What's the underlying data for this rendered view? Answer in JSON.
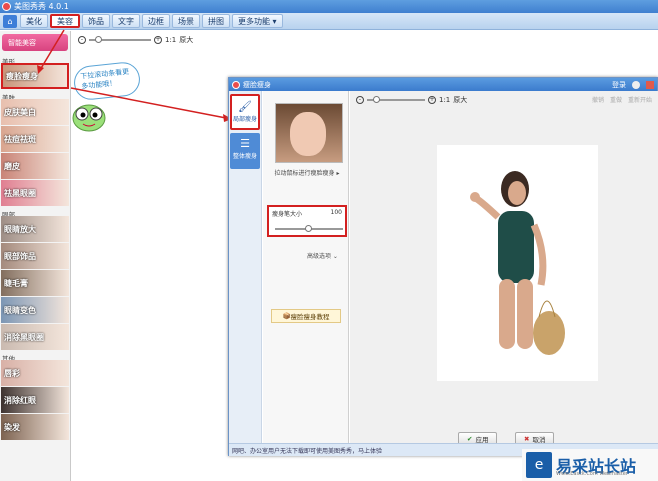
{
  "app": {
    "title": "美图秀秀 4.0.1"
  },
  "menu": {
    "home_icon": "home-icon",
    "tabs": [
      "美化",
      "美容",
      "饰品",
      "文字",
      "边框",
      "场景",
      "拼图",
      "更多功能"
    ],
    "active": "美容"
  },
  "sidebar": {
    "oneclick": "智能美容",
    "sections": [
      {
        "title": "美形",
        "items": [
          {
            "label": "瘦脸瘦身",
            "selected": true,
            "color": "#c9957a"
          }
        ]
      },
      {
        "title": "美肤",
        "items": [
          {
            "label": "皮肤美白",
            "color": "#e8bfae"
          },
          {
            "label": "祛痘祛斑",
            "color": "#d9a58f"
          },
          {
            "label": "磨皮",
            "color": "#c98477"
          },
          {
            "label": "祛黑眼圈",
            "color": "#e07e91"
          }
        ]
      },
      {
        "title": "眼部",
        "items": [
          {
            "label": "眼睛放大",
            "color": "#9e8e86"
          },
          {
            "label": "眼部饰品",
            "color": "#a48a7d"
          },
          {
            "label": "睫毛膏",
            "color": "#826e5e"
          },
          {
            "label": "眼睛变色",
            "color": "#7c96b4"
          },
          {
            "label": "消除黑眼圈",
            "color": "#cabab0"
          }
        ]
      },
      {
        "title": "其他",
        "items": [
          {
            "label": "唇彩",
            "color": "#d8b0a6"
          },
          {
            "label": "消除红眼",
            "color": "#3e3330"
          },
          {
            "label": "染发",
            "color": "#7d6351"
          }
        ]
      }
    ]
  },
  "zoombar": {
    "ratio": "1:1",
    "label": "原大"
  },
  "bubble": {
    "text": "下拉滚动条看更多功能哦！"
  },
  "dialog": {
    "title": "瘦脸瘦身",
    "login": "登录",
    "tabs": [
      {
        "label": "局部瘦身",
        "active": true
      },
      {
        "label": "整体瘦身",
        "active": false
      }
    ],
    "preview_tip": "拉动鼠标进行瘦脸瘦身 ▸",
    "pen": {
      "label": "瘦身笔大小",
      "value": "100"
    },
    "advanced": "高级选项",
    "tutorial": "瘦脸瘦身教程",
    "toolbar": {
      "ratio": "1:1",
      "label": "原大",
      "undo": "撤销",
      "redo": "重做",
      "reset": "重新开始"
    },
    "buttons": {
      "apply": "应用",
      "cancel": "取消"
    },
    "status": "网吧、办公室用户无法下载即可使用美图秀秀，马上体验"
  },
  "brand": {
    "name": "易采站长站",
    "url": "Www.Easck.Com  Webmaster"
  }
}
